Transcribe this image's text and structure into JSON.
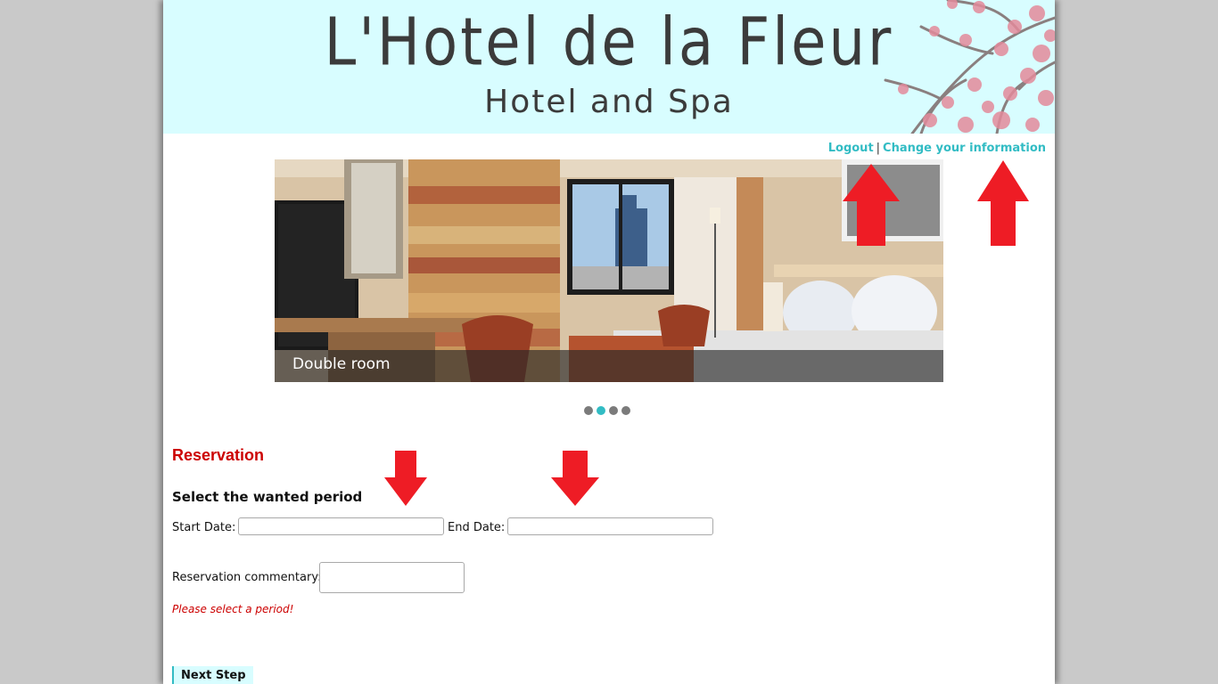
{
  "header": {
    "hotel_name": "L'Hotel de la Fleur",
    "subtitle": "Hotel and Spa"
  },
  "top_links": {
    "logout": "Logout",
    "separator": "|",
    "change_info": "Change your information"
  },
  "slideshow": {
    "caption": "Double room",
    "slide_count": 4,
    "active_index": 1
  },
  "reservation": {
    "title": "Reservation",
    "period_title": "Select the wanted period",
    "start_label": "Start Date:",
    "start_value": "",
    "end_label": "End Date:",
    "end_value": "",
    "comment_label": "Reservation commentary:",
    "comment_value": "",
    "error": "Please select a period!",
    "next_button": "Next Step"
  },
  "colors": {
    "accent": "#32bcc4",
    "header_bg": "#d8fdff",
    "error": "#cc0000",
    "annotation_arrow": "#ee1c25"
  }
}
